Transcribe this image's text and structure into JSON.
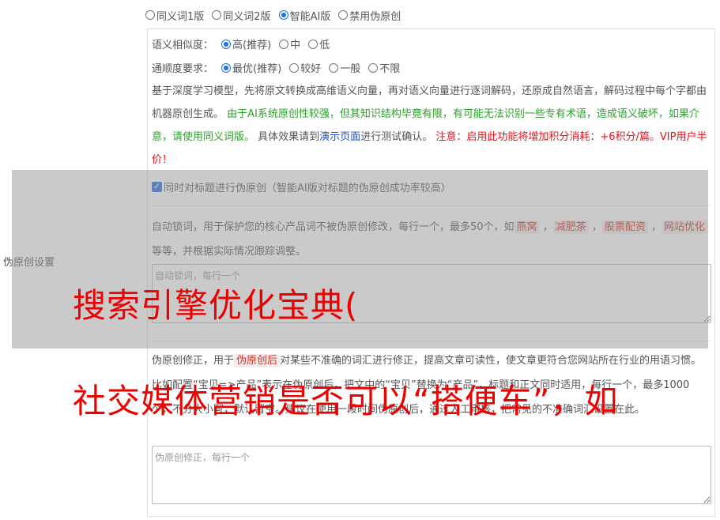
{
  "modes": {
    "options": [
      "同义词1版",
      "同义词2版",
      "智能AI版",
      "禁用伪原创"
    ],
    "selected_index": 2
  },
  "similarity": {
    "label": "语义相似度：",
    "options": [
      "高(推荐)",
      "中",
      "低"
    ],
    "selected_index": 0
  },
  "fluency": {
    "label": "通顺度要求：",
    "options": [
      "最优(推荐)",
      "较好",
      "一般",
      "不限"
    ],
    "selected_index": 0
  },
  "description": {
    "p1": "基于深度学习模型，先将原文转换成高维语义向量，再对语义向量进行逐词解码，还原成自然语言，解码过程中每个字都由机器原创生成。",
    "green": "由于AI系统原创性较强，但其知识结构毕竟有限，有可能无法识别一些专有术语，造成语义破坏，如果介意，请使用同义词版。",
    "p2": "具体效果请到",
    "link": "演示页面",
    "p3": "进行测试确认。",
    "red": "注意：启用此功能将增加积分消耗：+6积分/篇。VIP用户半价！"
  },
  "section_label": "伪原创设置",
  "title_checkbox": {
    "label": "同时对标题进行伪原创（智能AI版对标题的伪原创成功率较高）",
    "checked": true
  },
  "lock_words": {
    "intro": "自动锁词，用于保护您的核心产品词不被伪原创修改，每行一个，最多50个，如",
    "examples": [
      "燕窝",
      "减肥茶",
      "股票配资",
      "网站优化"
    ],
    "outro": "等等，并根据实际情况跟踪调整。",
    "placeholder": "自动锁词，每行一个"
  },
  "correction": {
    "intro": "伪原创修正，用于",
    "tag": "伪原创后",
    "text": "对某些不准确的词汇进行修正，提高文章可读性，使文章更符合您网站所在行业的用语习惯。比如配置“宝贝=>产品”表示在伪原创后，把文中的“宝贝”替换为“产品”，标题和正文同时适用，每行一个，最多1000个，不分大小写，默认留空。建议在使用一段时间伪原创后，通过人工审核，把常见的不准确词汇设置在此。",
    "placeholder": "伪原创修正，每行一个"
  },
  "watermarks": [
    "搜索引擎优化宝典(",
    "社交媒体营销是否可以“搭便车”，如"
  ]
}
